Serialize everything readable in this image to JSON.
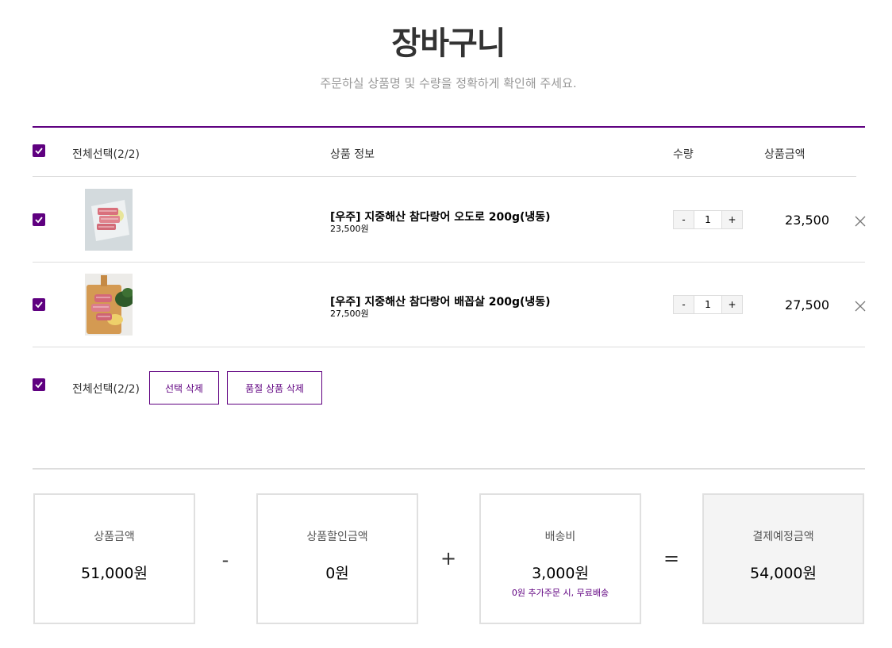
{
  "page": {
    "title": "장바구니",
    "subtitle": "주문하실 상품명 및 수량을 정확하게 확인해 주세요."
  },
  "table_header": {
    "select_all": "전체선택(2/2)",
    "product_info": "상품 정보",
    "quantity": "수량",
    "amount": "상품금액"
  },
  "items": [
    {
      "name": "[우주] 지중해산 참다랑어 오도로 200g(냉동)",
      "unit_price": "23,500원",
      "quantity": "1",
      "total": "23,500",
      "checked": true
    },
    {
      "name": "[우주] 지중해산 참다랑어 배꼽살 200g(냉동)",
      "unit_price": "27,500원",
      "quantity": "1",
      "total": "27,500",
      "checked": true
    }
  ],
  "qty_controls": {
    "minus": "-",
    "plus": "+"
  },
  "bottom_actions": {
    "select_all": "전체선택(2/2)",
    "delete_selected": "선택 삭제",
    "delete_soldout": "품절 상품 삭제"
  },
  "summary": {
    "product_amount": {
      "label": "상품금액",
      "value": "51,000원"
    },
    "discount": {
      "label": "상품할인금액",
      "value": "0원"
    },
    "delivery": {
      "label": "배송비",
      "value": "3,000원",
      "note": "0원 추가주문 시, 무료배송"
    },
    "final": {
      "label": "결제예정금액",
      "value": "54,000원"
    },
    "operators": {
      "minus": "-",
      "plus": "+",
      "equals": "="
    }
  },
  "colors": {
    "accent": "#5f0080",
    "divider": "#dddddd",
    "final_box_bg": "#f4f4f4"
  },
  "icons": [
    "checkbox-checked-icon",
    "close-icon"
  ]
}
